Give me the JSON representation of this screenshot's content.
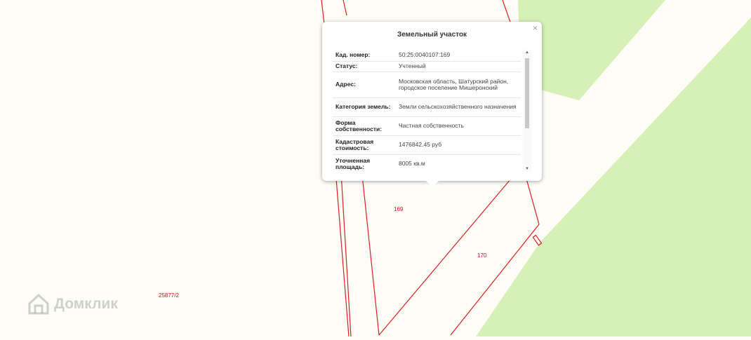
{
  "map": {
    "colors": {
      "background": "#fdfdf6",
      "green_area": "#d6f0b8",
      "boundary": "#d91e24"
    },
    "parcel_labels": [
      "169",
      "170",
      "25877/2"
    ]
  },
  "popup": {
    "title": "Земельный участок",
    "close_symbol": "×",
    "rows": [
      {
        "key": "Кад. номер:",
        "value": "50:25:0040107:169"
      },
      {
        "key": "Статус:",
        "value": "Учтенный"
      },
      {
        "key": "Адрес:",
        "value": "Московская область, Шатурский район, городское поселение Мишеронский"
      },
      {
        "key": "Категория земель:",
        "value": "Земли сельскохозяйственного назначения"
      },
      {
        "key": "Форма собственности:",
        "value": "Частная собственность"
      },
      {
        "key": "Кадастровая стоимость:",
        "value": "1476842.45 руб"
      },
      {
        "key": "Уточненная площадь:",
        "value": "8005 кв.м"
      }
    ]
  },
  "watermark": {
    "text": "Домклик",
    "icon": "house-logo-icon"
  }
}
